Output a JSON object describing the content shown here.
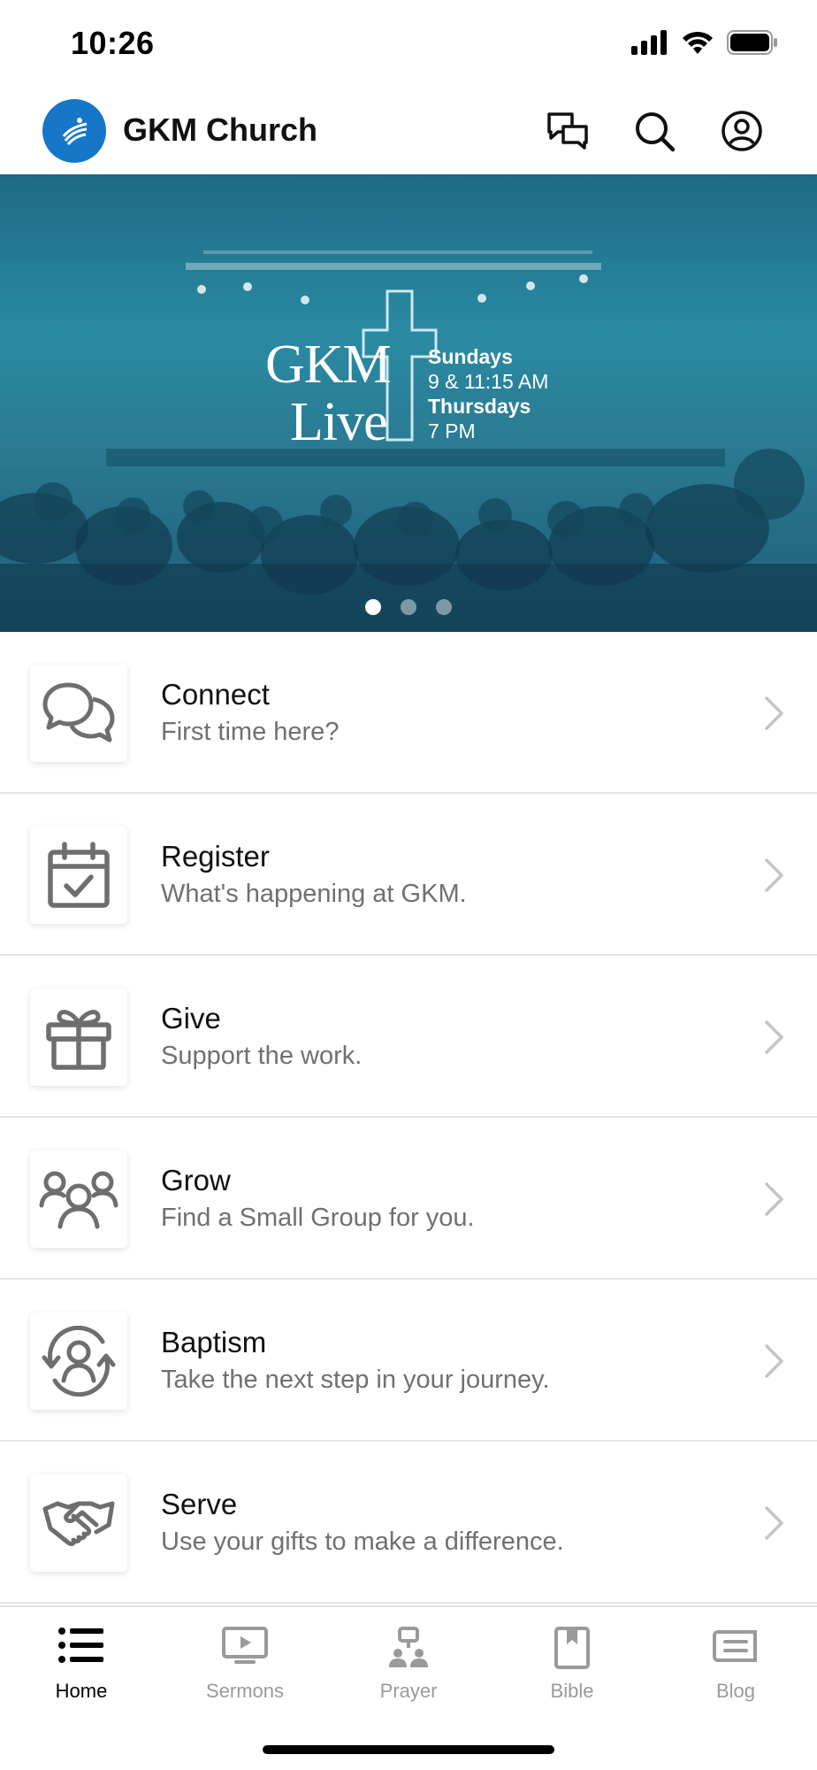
{
  "status_bar": {
    "time": "10:26"
  },
  "header": {
    "title": "GKM Church",
    "icons": [
      "chat-icon",
      "search-icon",
      "profile-icon"
    ],
    "logo_color": "#1676c8"
  },
  "hero": {
    "title_line1": "GKM",
    "title_line2": "Live",
    "schedule": [
      "Sundays",
      "9 & 11:15 AM",
      "Thursdays",
      "7 PM"
    ],
    "slide_count": 3,
    "active_slide": 1
  },
  "menu": [
    {
      "title": "Connect",
      "subtitle": "First time here?",
      "icon": "chat-bubbles-icon"
    },
    {
      "title": "Register",
      "subtitle": "What's happening at GKM.",
      "icon": "calendar-check-icon"
    },
    {
      "title": "Give",
      "subtitle": "Support the work.",
      "icon": "gift-icon"
    },
    {
      "title": "Grow",
      "subtitle": "Find a Small Group for you.",
      "icon": "group-icon"
    },
    {
      "title": "Baptism",
      "subtitle": "Take the next step in your journey.",
      "icon": "person-cycle-icon"
    },
    {
      "title": "Serve",
      "subtitle": "Use your gifts to make a difference.",
      "icon": "handshake-icon"
    }
  ],
  "bottom_nav": [
    {
      "label": "Home",
      "icon": "list-icon",
      "active": true
    },
    {
      "label": "Sermons",
      "icon": "video-icon",
      "active": false
    },
    {
      "label": "Prayer",
      "icon": "prayer-icon",
      "active": false
    },
    {
      "label": "Bible",
      "icon": "book-icon",
      "active": false
    },
    {
      "label": "Blog",
      "icon": "blog-icon",
      "active": false
    }
  ],
  "colors": {
    "icon_gray": "#6e6e6e",
    "accent_blue": "#1676c8",
    "hero_teal": "#2a8aa2"
  }
}
